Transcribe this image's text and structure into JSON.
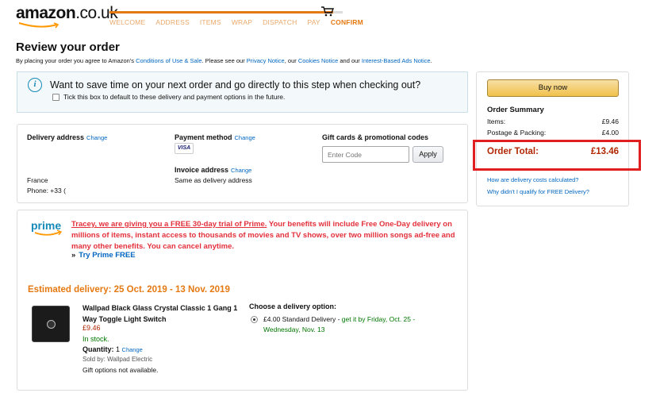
{
  "header": {
    "logo_main": "amazon",
    "logo_tld": ".co.uk",
    "steps": [
      "WELCOME",
      "ADDRESS",
      "ITEMS",
      "WRAP",
      "DISPATCH",
      "PAY"
    ],
    "active_step": "CONFIRM",
    "cart_icon": "shopping-cart-icon"
  },
  "page": {
    "title": "Review your order",
    "agree_prefix": "By placing your order you agree to Amazon's ",
    "conditions_link": "Conditions of Use & Sale",
    "agree_mid1": ". Please see our ",
    "privacy_link": "Privacy Notice",
    "agree_mid2": ", our ",
    "cookies_link": "Cookies Notice",
    "agree_mid3": " and our ",
    "ads_link": "Interest-Based Ads Notice",
    "agree_end": "."
  },
  "info_box": {
    "icon": "info-icon",
    "question": "Want to save time on your next order and go directly to this step when checking out?",
    "checkbox_label": "Tick this box to default to these delivery and payment options in the future."
  },
  "delivery": {
    "label": "Delivery address",
    "change": "Change",
    "country": "France",
    "phone": "Phone: +33 ("
  },
  "payment": {
    "label": "Payment method",
    "change": "Change",
    "card": "VISA",
    "invoice_label": "Invoice address",
    "invoice_change": "Change",
    "invoice_value": "Same as delivery address"
  },
  "gift": {
    "label": "Gift cards & promotional codes",
    "placeholder": "Enter Code",
    "apply": "Apply"
  },
  "prime": {
    "logo": "prime",
    "offer_link": "Tracey, we are giving you a FREE 30-day trial of Prime.",
    "offer_rest": " Your benefits will include Free One-Day delivery on millions of items, instant access to thousands of movies and TV shows, over two million songs ad-free and many other benefits. You can cancel anytime.",
    "try_arrow": "»",
    "try_label": "Try Prime FREE"
  },
  "shipment": {
    "estimated": "Estimated delivery:  25 Oct. 2019 - 13 Nov. 2019",
    "product_title": "Wallpad Black Glass Crystal Classic 1 Gang 1 Way Toggle Light Switch",
    "price": "£9.46",
    "stock": "In stock.",
    "qty_label": "Quantity:",
    "qty_value": "1",
    "qty_change": "Change",
    "sold_by": "Sold by: Wallpad Electric",
    "gift_note": "Gift options not available.",
    "option_title": "Choose a delivery option:",
    "option_price": "£4.00 Standard Delivery",
    "option_sep": " - ",
    "option_date": "get it by Friday, Oct. 25 - Wednesday, Nov. 13"
  },
  "summary": {
    "buy_now": "Buy now",
    "title": "Order Summary",
    "items_label": "Items:",
    "items_value": "£9.46",
    "postage_label": "Postage & Packing:",
    "postage_value": "£4.00",
    "total_label": "Order Total:",
    "total_value": "£13.46",
    "link1": "How are delivery costs calculated?",
    "link2": "Why didn't I qualify for FREE Delivery?"
  }
}
